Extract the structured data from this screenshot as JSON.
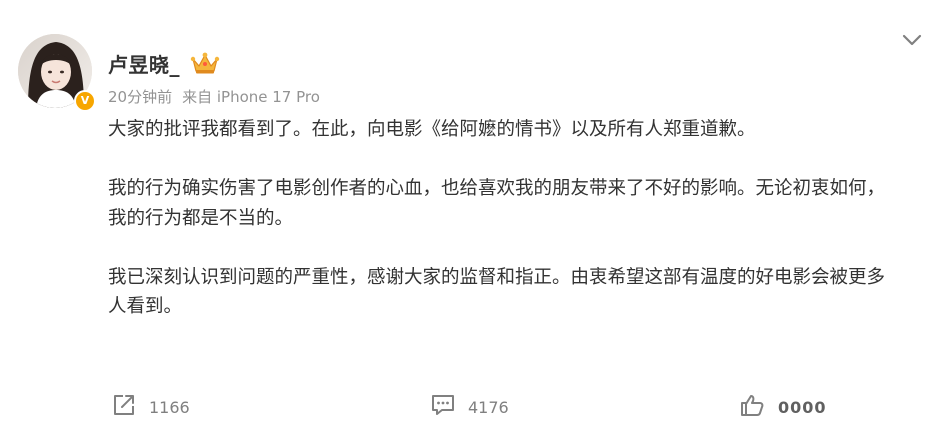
{
  "post": {
    "author": {
      "name": "卢昱晓_",
      "badge_icon": "crown-icon",
      "verified_icon": "verified-v-icon",
      "verified_color": "#f7a600"
    },
    "time": "20分钟前",
    "source": "来自 iPhone 17 Pro",
    "paragraphs": [
      "大家的批评我都看到了。在此，向电影《给阿嬷的情书》以及所有人郑重道歉。",
      "我的行为确实伤害了电影创作者的心血，也给喜欢我的朋友带来了不好的影响。无论初衷如何，我的行为都是不当的。",
      "我已深刻认识到问题的严重性，感谢大家的监督和指正。由衷希望这部有温度的好电影会被更多人看到。"
    ]
  },
  "actions": {
    "repost": {
      "icon": "share-icon",
      "count": "1166"
    },
    "comment": {
      "icon": "comment-icon",
      "count": "4176"
    },
    "like": {
      "icon": "thumbs-up-icon",
      "count": "0000"
    }
  },
  "menu": {
    "icon": "chevron-down-icon"
  }
}
